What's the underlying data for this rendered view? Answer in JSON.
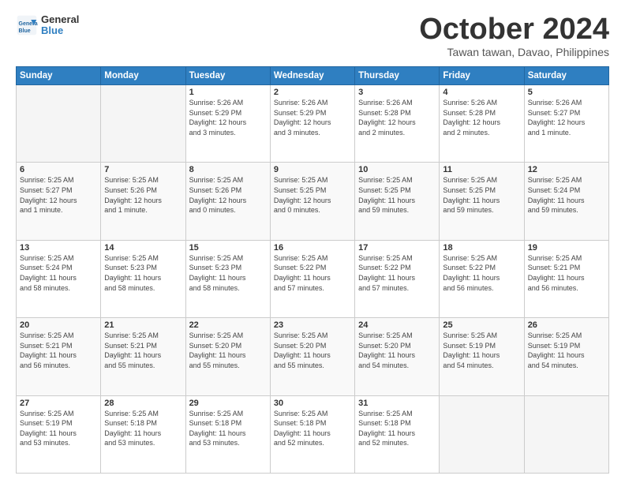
{
  "header": {
    "logo_line1": "General",
    "logo_line2": "Blue",
    "month": "October 2024",
    "location": "Tawan tawan, Davao, Philippines"
  },
  "weekdays": [
    "Sunday",
    "Monday",
    "Tuesday",
    "Wednesday",
    "Thursday",
    "Friday",
    "Saturday"
  ],
  "weeks": [
    [
      {
        "day": "",
        "detail": ""
      },
      {
        "day": "",
        "detail": ""
      },
      {
        "day": "1",
        "detail": "Sunrise: 5:26 AM\nSunset: 5:29 PM\nDaylight: 12 hours\nand 3 minutes."
      },
      {
        "day": "2",
        "detail": "Sunrise: 5:26 AM\nSunset: 5:29 PM\nDaylight: 12 hours\nand 3 minutes."
      },
      {
        "day": "3",
        "detail": "Sunrise: 5:26 AM\nSunset: 5:28 PM\nDaylight: 12 hours\nand 2 minutes."
      },
      {
        "day": "4",
        "detail": "Sunrise: 5:26 AM\nSunset: 5:28 PM\nDaylight: 12 hours\nand 2 minutes."
      },
      {
        "day": "5",
        "detail": "Sunrise: 5:26 AM\nSunset: 5:27 PM\nDaylight: 12 hours\nand 1 minute."
      }
    ],
    [
      {
        "day": "6",
        "detail": "Sunrise: 5:25 AM\nSunset: 5:27 PM\nDaylight: 12 hours\nand 1 minute."
      },
      {
        "day": "7",
        "detail": "Sunrise: 5:25 AM\nSunset: 5:26 PM\nDaylight: 12 hours\nand 1 minute."
      },
      {
        "day": "8",
        "detail": "Sunrise: 5:25 AM\nSunset: 5:26 PM\nDaylight: 12 hours\nand 0 minutes."
      },
      {
        "day": "9",
        "detail": "Sunrise: 5:25 AM\nSunset: 5:25 PM\nDaylight: 12 hours\nand 0 minutes."
      },
      {
        "day": "10",
        "detail": "Sunrise: 5:25 AM\nSunset: 5:25 PM\nDaylight: 11 hours\nand 59 minutes."
      },
      {
        "day": "11",
        "detail": "Sunrise: 5:25 AM\nSunset: 5:25 PM\nDaylight: 11 hours\nand 59 minutes."
      },
      {
        "day": "12",
        "detail": "Sunrise: 5:25 AM\nSunset: 5:24 PM\nDaylight: 11 hours\nand 59 minutes."
      }
    ],
    [
      {
        "day": "13",
        "detail": "Sunrise: 5:25 AM\nSunset: 5:24 PM\nDaylight: 11 hours\nand 58 minutes."
      },
      {
        "day": "14",
        "detail": "Sunrise: 5:25 AM\nSunset: 5:23 PM\nDaylight: 11 hours\nand 58 minutes."
      },
      {
        "day": "15",
        "detail": "Sunrise: 5:25 AM\nSunset: 5:23 PM\nDaylight: 11 hours\nand 58 minutes."
      },
      {
        "day": "16",
        "detail": "Sunrise: 5:25 AM\nSunset: 5:22 PM\nDaylight: 11 hours\nand 57 minutes."
      },
      {
        "day": "17",
        "detail": "Sunrise: 5:25 AM\nSunset: 5:22 PM\nDaylight: 11 hours\nand 57 minutes."
      },
      {
        "day": "18",
        "detail": "Sunrise: 5:25 AM\nSunset: 5:22 PM\nDaylight: 11 hours\nand 56 minutes."
      },
      {
        "day": "19",
        "detail": "Sunrise: 5:25 AM\nSunset: 5:21 PM\nDaylight: 11 hours\nand 56 minutes."
      }
    ],
    [
      {
        "day": "20",
        "detail": "Sunrise: 5:25 AM\nSunset: 5:21 PM\nDaylight: 11 hours\nand 56 minutes."
      },
      {
        "day": "21",
        "detail": "Sunrise: 5:25 AM\nSunset: 5:21 PM\nDaylight: 11 hours\nand 55 minutes."
      },
      {
        "day": "22",
        "detail": "Sunrise: 5:25 AM\nSunset: 5:20 PM\nDaylight: 11 hours\nand 55 minutes."
      },
      {
        "day": "23",
        "detail": "Sunrise: 5:25 AM\nSunset: 5:20 PM\nDaylight: 11 hours\nand 55 minutes."
      },
      {
        "day": "24",
        "detail": "Sunrise: 5:25 AM\nSunset: 5:20 PM\nDaylight: 11 hours\nand 54 minutes."
      },
      {
        "day": "25",
        "detail": "Sunrise: 5:25 AM\nSunset: 5:19 PM\nDaylight: 11 hours\nand 54 minutes."
      },
      {
        "day": "26",
        "detail": "Sunrise: 5:25 AM\nSunset: 5:19 PM\nDaylight: 11 hours\nand 54 minutes."
      }
    ],
    [
      {
        "day": "27",
        "detail": "Sunrise: 5:25 AM\nSunset: 5:19 PM\nDaylight: 11 hours\nand 53 minutes."
      },
      {
        "day": "28",
        "detail": "Sunrise: 5:25 AM\nSunset: 5:18 PM\nDaylight: 11 hours\nand 53 minutes."
      },
      {
        "day": "29",
        "detail": "Sunrise: 5:25 AM\nSunset: 5:18 PM\nDaylight: 11 hours\nand 53 minutes."
      },
      {
        "day": "30",
        "detail": "Sunrise: 5:25 AM\nSunset: 5:18 PM\nDaylight: 11 hours\nand 52 minutes."
      },
      {
        "day": "31",
        "detail": "Sunrise: 5:25 AM\nSunset: 5:18 PM\nDaylight: 11 hours\nand 52 minutes."
      },
      {
        "day": "",
        "detail": ""
      },
      {
        "day": "",
        "detail": ""
      }
    ]
  ]
}
